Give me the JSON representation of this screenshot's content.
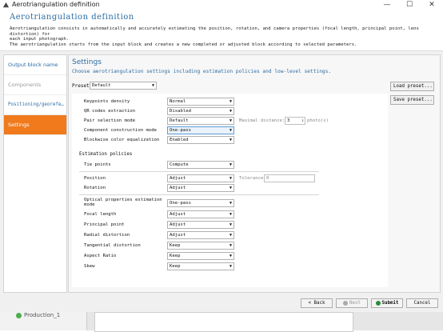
{
  "window": {
    "title": "Aerotriangulation definition",
    "minimize": "—",
    "maximize": "☐",
    "close": "✕"
  },
  "header": {
    "title": "Aerotriangulation definition",
    "desc1": "Aerotriangulation consists in automatically and accurately estimating the position, rotation, and camera properties (focal length, principal point, lens distortion) for",
    "desc2": "each input photograph.",
    "desc3": "The aerotriangulation starts from the input block and creates a new completed or adjusted block according to selected parameters."
  },
  "sidebar": {
    "items": [
      {
        "label": "Output block name"
      },
      {
        "label": "Components"
      },
      {
        "label": "Positioning/georefe…"
      },
      {
        "label": "Settings"
      }
    ]
  },
  "settings": {
    "title": "Settings",
    "subtitle": "Choose aerotriangulation settings including estimation policies and low-level settings.",
    "preset_label": "Preset:",
    "preset_value": "Default",
    "load_preset": "Load preset...",
    "save_preset": "Save preset...",
    "rows": {
      "keypoints": {
        "label": "Keypoints density",
        "value": "Normal"
      },
      "qr": {
        "label": "QR codes extraction",
        "value": "Disabled"
      },
      "pair": {
        "label": "Pair selection mode",
        "value": "Default"
      },
      "component": {
        "label": "Component construction mode",
        "value": "One-pass"
      },
      "blockwise": {
        "label": "Blockwise color equalization",
        "value": "Enabled"
      },
      "tie": {
        "label": "Tie points",
        "value": "Compute"
      },
      "position": {
        "label": "Position",
        "value": "Adjust"
      },
      "rotation": {
        "label": "Rotation",
        "value": "Adjust"
      },
      "optical": {
        "label1": "Optical properties estimation",
        "label2": "mode",
        "value": "One-pass"
      },
      "focal": {
        "label": "Focal length",
        "value": "Adjust"
      },
      "principal": {
        "label": "Principal point",
        "value": "Adjust"
      },
      "radial": {
        "label": "Radial distortion",
        "value": "Adjust"
      },
      "tangential": {
        "label": "Tangential distortion",
        "value": "Keep"
      },
      "aspect": {
        "label": "Aspect Ratio",
        "value": "Keep"
      },
      "skew": {
        "label": "Skew",
        "value": "Keep"
      }
    },
    "max_distance_label": "Maximal distance:",
    "max_distance_value": "3",
    "max_distance_unit": "photo(s)",
    "estimation_policies": "Estimation policies",
    "tolerance_label": "Tolerance",
    "tolerance_value": "0"
  },
  "footer": {
    "back": "< Back",
    "next": "Next",
    "submit": "Submit",
    "cancel": "Cancel"
  },
  "taskbar": {
    "production": "Production_1"
  }
}
